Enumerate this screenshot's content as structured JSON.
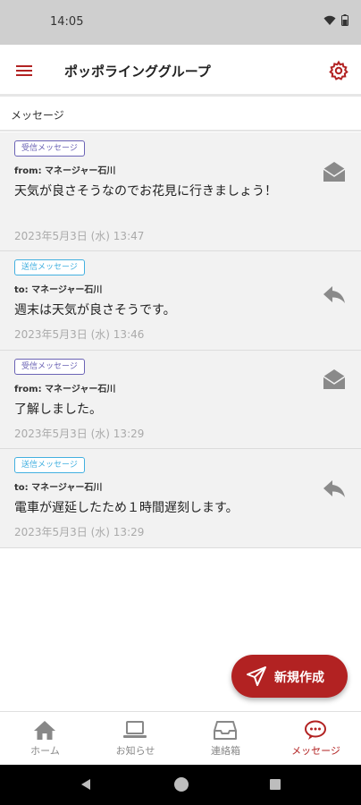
{
  "status": {
    "time": "14:05"
  },
  "header": {
    "title": "ポッポラインググループ"
  },
  "section": {
    "title": "メッセージ"
  },
  "messages": [
    {
      "type": "received",
      "badge": "受信メッセージ",
      "party": "from: マネージャー石川",
      "text": "天気が良さそうなのでお花見に行きましょう！",
      "time": "2023年5月3日 (水) 13:47",
      "icon": "envelope-icon"
    },
    {
      "type": "sent",
      "badge": "送信メッセージ",
      "party": "to: マネージャー石川",
      "text": "週末は天気が良さそうです。",
      "time": "2023年5月3日 (水) 13:46",
      "icon": "reply-icon"
    },
    {
      "type": "received",
      "badge": "受信メッセージ",
      "party": "from: マネージャー石川",
      "text": "了解しました。",
      "time": "2023年5月3日 (水) 13:29",
      "icon": "envelope-icon"
    },
    {
      "type": "sent",
      "badge": "送信メッセージ",
      "party": "to: マネージャー石川",
      "text": "電車が遅延したため１時間遅刻します。",
      "time": "2023年5月3日 (水) 13:29",
      "icon": "reply-icon"
    }
  ],
  "fab": {
    "label": "新規作成"
  },
  "nav": {
    "home": "ホーム",
    "notice": "お知らせ",
    "contact": "連絡箱",
    "messages": "メッセージ"
  },
  "colors": {
    "accent": "#b22222",
    "received_badge": "#6b63b5",
    "sent_badge": "#43b0e0"
  }
}
